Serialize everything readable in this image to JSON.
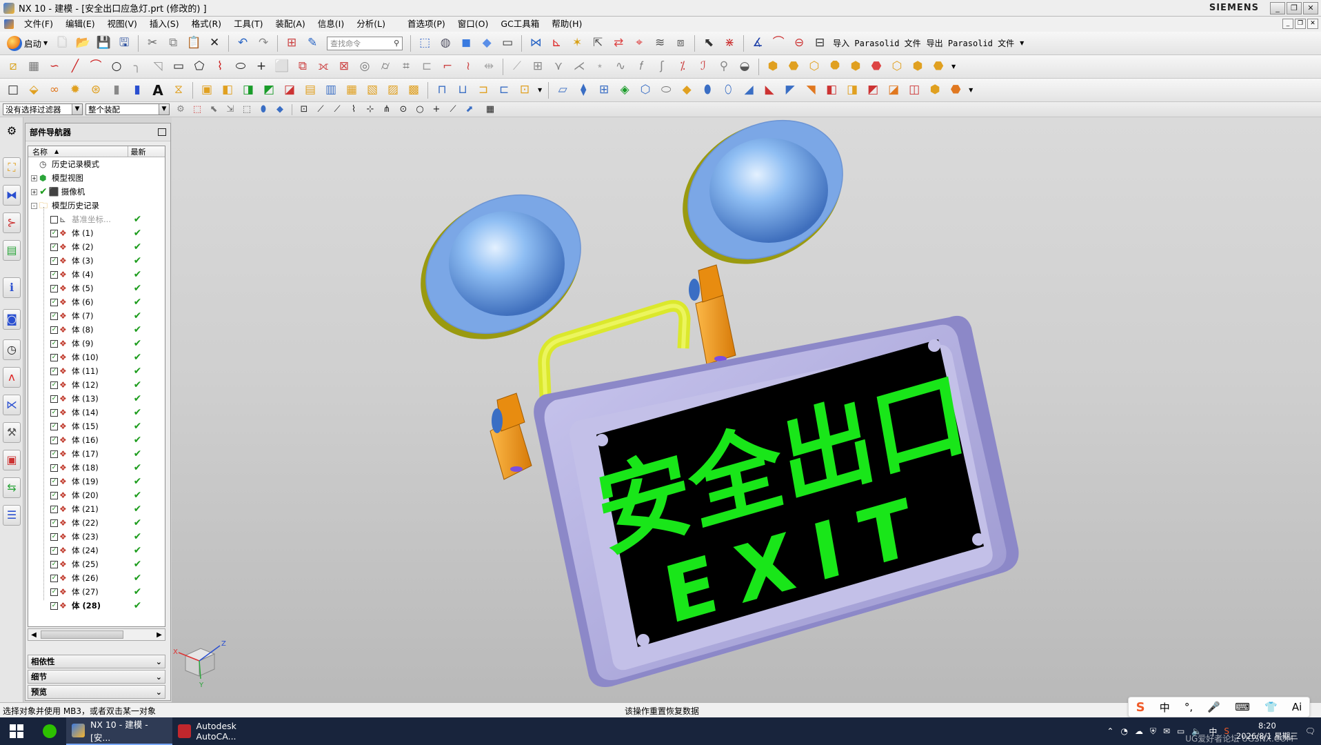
{
  "window": {
    "title": "NX 10 - 建模 - [安全出口应急灯.prt  (修改的) ]",
    "brand": "SIEMENS",
    "controls": [
      "_",
      "❐",
      "✕"
    ]
  },
  "menubar": {
    "items": [
      "文件(F)",
      "编辑(E)",
      "视图(V)",
      "插入(S)",
      "格式(R)",
      "工具(T)",
      "装配(A)",
      "信息(I)",
      "分析(L)",
      "首选项(P)",
      "窗口(O)",
      "GC工具箱",
      "帮助(H)"
    ]
  },
  "toolbar1": {
    "start_label": "启动",
    "search_placeholder": "查找命令",
    "import_label": "导入 Parasolid 文件",
    "export_label": "导出 Parasolid 文件"
  },
  "selectionbar": {
    "filter_value": "没有选择过滤器",
    "scope_value": "整个装配"
  },
  "navigator": {
    "title": "部件导航器",
    "col_name": "名称",
    "col_latest": "最新",
    "rows": [
      {
        "level": 0,
        "label": "历史记录模式",
        "icon": "history-icon"
      },
      {
        "level": 0,
        "label": "模型视图",
        "icon": "model-views-icon",
        "expander": "+"
      },
      {
        "level": 0,
        "label": "摄像机",
        "icon": "camera-icon",
        "expander": "+",
        "check": true
      },
      {
        "level": 0,
        "label": "模型历史记录",
        "icon": "folder-icon",
        "expander": "-"
      },
      {
        "level": 1,
        "label": "基准坐标...",
        "icon": "datum-csys-icon",
        "dim": true,
        "checked": false,
        "latest": true
      },
      {
        "level": 1,
        "label": "体 (1)",
        "latest": true,
        "checked": true
      },
      {
        "level": 1,
        "label": "体 (2)",
        "latest": true,
        "checked": true
      },
      {
        "level": 1,
        "label": "体 (3)",
        "latest": true,
        "checked": true
      },
      {
        "level": 1,
        "label": "体 (4)",
        "latest": true,
        "checked": true
      },
      {
        "level": 1,
        "label": "体 (5)",
        "latest": true,
        "checked": true
      },
      {
        "level": 1,
        "label": "体 (6)",
        "latest": true,
        "checked": true
      },
      {
        "level": 1,
        "label": "体 (7)",
        "latest": true,
        "checked": true
      },
      {
        "level": 1,
        "label": "体 (8)",
        "latest": true,
        "checked": true
      },
      {
        "level": 1,
        "label": "体 (9)",
        "latest": true,
        "checked": true
      },
      {
        "level": 1,
        "label": "体 (10)",
        "latest": true,
        "checked": true
      },
      {
        "level": 1,
        "label": "体 (11)",
        "latest": true,
        "checked": true
      },
      {
        "level": 1,
        "label": "体 (12)",
        "latest": true,
        "checked": true
      },
      {
        "level": 1,
        "label": "体 (13)",
        "latest": true,
        "checked": true
      },
      {
        "level": 1,
        "label": "体 (14)",
        "latest": true,
        "checked": true
      },
      {
        "level": 1,
        "label": "体 (15)",
        "latest": true,
        "checked": true
      },
      {
        "level": 1,
        "label": "体 (16)",
        "latest": true,
        "checked": true
      },
      {
        "level": 1,
        "label": "体 (17)",
        "latest": true,
        "checked": true
      },
      {
        "level": 1,
        "label": "体 (18)",
        "latest": true,
        "checked": true
      },
      {
        "level": 1,
        "label": "体 (19)",
        "latest": true,
        "checked": true
      },
      {
        "level": 1,
        "label": "体 (20)",
        "latest": true,
        "checked": true
      },
      {
        "level": 1,
        "label": "体 (21)",
        "latest": true,
        "checked": true
      },
      {
        "level": 1,
        "label": "体 (22)",
        "latest": true,
        "checked": true
      },
      {
        "level": 1,
        "label": "体 (23)",
        "latest": true,
        "checked": true
      },
      {
        "level": 1,
        "label": "体 (24)",
        "latest": true,
        "checked": true
      },
      {
        "level": 1,
        "label": "体 (25)",
        "latest": true,
        "checked": true
      },
      {
        "level": 1,
        "label": "体 (26)",
        "latest": true,
        "checked": true
      },
      {
        "level": 1,
        "label": "体 (27)",
        "latest": true,
        "checked": true
      },
      {
        "level": 1,
        "label": "体 (28)",
        "latest": true,
        "checked": true,
        "bold": true
      }
    ],
    "sections": [
      "相依性",
      "细节",
      "预览"
    ]
  },
  "model": {
    "sign_text_cn": "安全出口",
    "sign_text_en": "EXIT",
    "colors": {
      "housing": "#b0ace0",
      "panel": "#000000",
      "text": "#19e619",
      "lamp": "#7fb0ec",
      "bracket": "#f39a1b",
      "handle": "#e6f236"
    }
  },
  "triad": {
    "x": "X",
    "y": "Y",
    "z": "Z"
  },
  "statusbar": {
    "left": "选择对象并使用 MB3，或者双击某一对象",
    "right": "该操作重置恢复数据"
  },
  "ime": {
    "items": [
      "S",
      "中",
      "°,",
      "🎤",
      "⌨",
      "👕",
      "Ai"
    ]
  },
  "taskbar": {
    "apps": [
      {
        "label": "",
        "icon": "wechat-icon"
      },
      {
        "label": "NX 10 - 建模 - [安...",
        "icon": "nx-icon",
        "active": true
      },
      {
        "label": "Autodesk AutoCA...",
        "icon": "autocad-icon"
      }
    ],
    "time": "8:20",
    "date": "2026/8/1 星期三",
    "watermark": "UG爱好者论坛 UGSNX.COM"
  }
}
